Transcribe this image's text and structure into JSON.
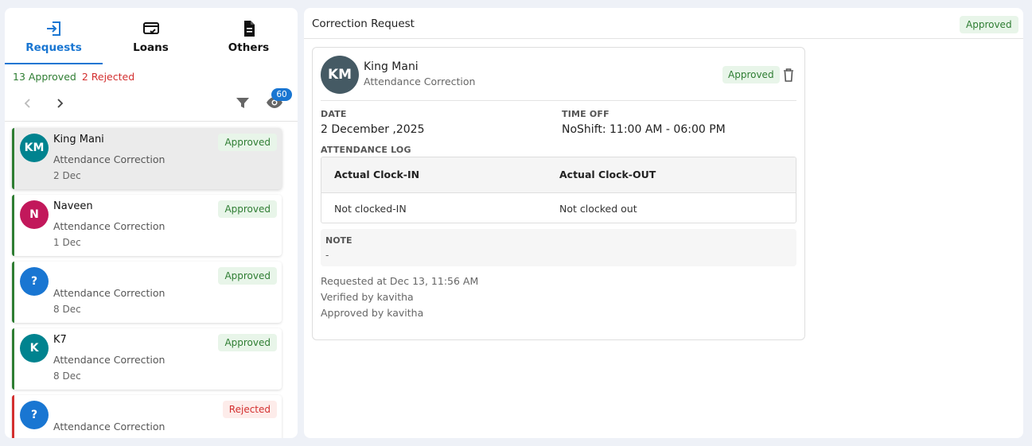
{
  "tabs": [
    {
      "label": "Requests",
      "icon": "login-arrow-icon",
      "active": true
    },
    {
      "label": "Loans",
      "icon": "card-check-icon",
      "active": false
    },
    {
      "label": "Others",
      "icon": "document-icon",
      "active": false
    }
  ],
  "summary": {
    "approved": "13 Approved",
    "rejected": "2 Rejected"
  },
  "toolbar": {
    "visible_count": "60"
  },
  "requests": [
    {
      "initials": "KM",
      "name": "King Mani",
      "type": "Attendance Correction",
      "date": "2 Dec",
      "status": "Approved",
      "avatar_color": "#00838f",
      "selected": true
    },
    {
      "initials": "N",
      "name": "Naveen",
      "type": "Attendance Correction",
      "date": "1 Dec",
      "status": "Approved",
      "avatar_color": "#c2185b",
      "selected": false
    },
    {
      "initials": "?",
      "name": "",
      "type": "Attendance Correction",
      "date": "8 Dec",
      "status": "Approved",
      "avatar_color": "#1976d2",
      "selected": false
    },
    {
      "initials": "K",
      "name": "K7",
      "type": "Attendance Correction",
      "date": "8 Dec",
      "status": "Approved",
      "avatar_color": "#00838f",
      "selected": false
    },
    {
      "initials": "?",
      "name": "",
      "type": "Attendance Correction",
      "date": "",
      "status": "Rejected",
      "avatar_color": "#1976d2",
      "selected": false
    }
  ],
  "detail": {
    "title": "Correction Request",
    "status": "Approved",
    "initials": "KM",
    "name": "King Mani",
    "type": "Attendance Correction",
    "date_label": "DATE",
    "date_value": "2 December ,2025",
    "timeoff_label": "TIME OFF",
    "timeoff_value": "NoShift: 11:00 AM - 06:00 PM",
    "log_label": "ATTENDANCE LOG",
    "log_headers": [
      "Actual Clock-IN",
      "Actual Clock-OUT"
    ],
    "log_values": [
      "Not clocked-IN",
      "Not clocked out"
    ],
    "note_label": "NOTE",
    "note_value": "-",
    "requested_at": "Requested at Dec 13, 11:56 AM",
    "verified_by": "Verified by kavitha",
    "approved_by": "Approved by kavitha"
  },
  "colors": {
    "accent": "#1976d2",
    "approved": "#2e7d32",
    "rejected": "#d32f2f"
  }
}
